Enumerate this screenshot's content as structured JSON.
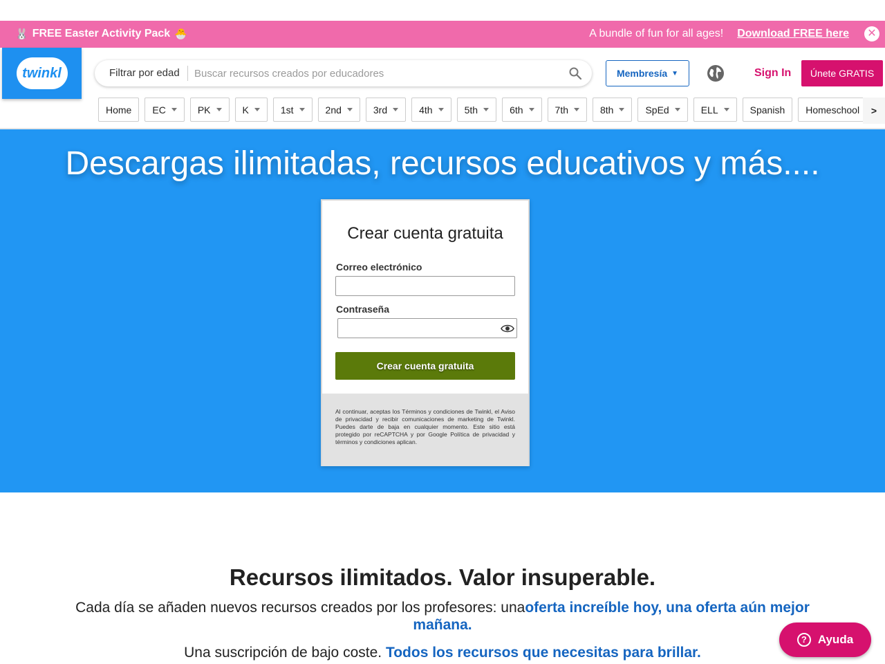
{
  "promo": {
    "bunny_emoji": "🐰",
    "title": "FREE Easter Activity Pack",
    "chick_emoji": "🐣",
    "tagline": "A bundle of fun for all ages!",
    "link": "Download FREE here",
    "close": "✕"
  },
  "header": {
    "logo_text": "twinkl",
    "filter_label": "Filtrar por edad",
    "search_placeholder": "Buscar recursos creados por educadores",
    "membership_label": "Membresía",
    "membership_caret": "▼",
    "signin": "Sign In",
    "join": "Únete GRATIS"
  },
  "grades": [
    "Home",
    "EC",
    "PK",
    "K",
    "1st",
    "2nd",
    "3rd",
    "4th",
    "5th",
    "6th",
    "7th",
    "8th",
    "SpEd",
    "ELL",
    "Spanish",
    "Homeschool"
  ],
  "grades_next": ">",
  "hero": {
    "title": "Descargas ilimitadas, recursos educativos y más....",
    "card": {
      "title": "Crear cuenta gratuita",
      "email_label": "Correo electrónico",
      "password_label": "Contraseña",
      "submit": "Crear cuenta gratuita",
      "legal": "Al continuar, aceptas los Términos y condiciones de Twinkl, el Aviso de privacidad y recibir comunicaciones de marketing de Twinkl. Puedes darte de baja en cualquier momento. Este sitio está protegido por reCAPTCHA y por Google Política de privacidad y términos y condiciones aplican."
    }
  },
  "section": {
    "title": "Recursos ilimitados. Valor insuperable.",
    "p1_text": "Cada día se añaden nuevos recursos creados por los profesores: una",
    "p1_highlight": "oferta increíble hoy, una oferta aún mejor mañana",
    "p1_end": ".",
    "p2_text": "Una suscripción de bajo coste. ",
    "p2_highlight": "Todos los recursos que necesitas para brillar."
  },
  "help": {
    "icon": "?",
    "label": "Ayuda"
  },
  "colors": {
    "promo_bg": "#f06aab",
    "brand_blue": "#2196f3",
    "brand_pink": "#d6116e",
    "submit_green": "#5b7a0a",
    "link_blue": "#1565c0"
  }
}
